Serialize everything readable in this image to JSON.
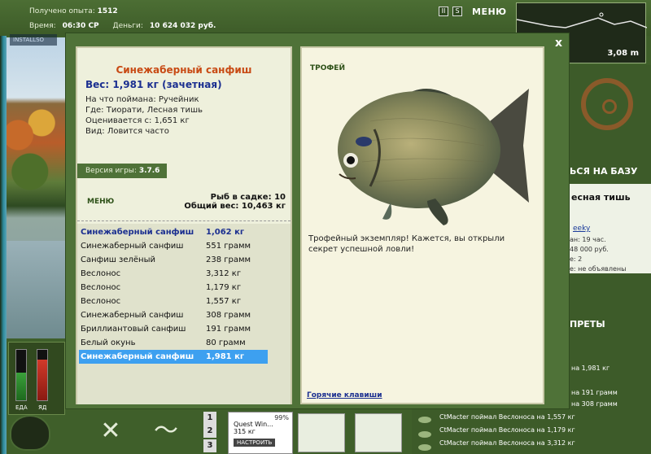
{
  "hud": {
    "exp_label": "Получено опыта:",
    "exp_value": "1512",
    "time_label": "Время:",
    "time_value": "06:30 СР",
    "money_label": "Деньги:",
    "money_value": "10 624 032 руб.",
    "installer_text": "INSTALLSO",
    "btn_pause": "II",
    "btn_s": "S",
    "menu_label": "МЕНЮ",
    "depth_value": "3,08 m"
  },
  "gauges": {
    "food_label": "ЕДА",
    "poison_label": "ЯД",
    "food_level": 0.55,
    "poison_level": 0.8
  },
  "fish": {
    "name": "Синежаберный санфиш",
    "weight_line": "Вес: 1,981 кг (зачетная)",
    "caught_on": "На что поймана: Ручейник",
    "location": "Где: Тиорати, Лесная тишь",
    "valued": "Оценивается с: 1,651 кг",
    "view": "Вид: Ловится часто"
  },
  "version": {
    "label": "Версия игры:",
    "value": "3.7.6"
  },
  "keepnet": {
    "menu_label": "МЕНЮ",
    "count_line": "Рыб в садке: 10",
    "total_line": "Общий вес: 10,463 кг",
    "rows": [
      {
        "name": "Синежаберный санфиш",
        "weight": "1,062 кг"
      },
      {
        "name": "Синежаберный санфиш",
        "weight": "551 грамм"
      },
      {
        "name": "Санфиш зелёный",
        "weight": "238 грамм"
      },
      {
        "name": "Веслонос",
        "weight": "3,312 кг"
      },
      {
        "name": "Веслонос",
        "weight": "1,179 кг"
      },
      {
        "name": "Веслонос",
        "weight": "1,557 кг"
      },
      {
        "name": "Синежаберный санфиш",
        "weight": "308 грамм"
      },
      {
        "name": "Бриллиантовый санфиш",
        "weight": "191 грамм"
      },
      {
        "name": "Белый окунь",
        "weight": "80 грамм"
      },
      {
        "name": "Синежаберный санфиш",
        "weight": "1,981 кг"
      }
    ]
  },
  "trophy": {
    "label": "ТРОФЕЙ",
    "description": "Трофейный экземпляр! Кажется, вы открыли секрет успешной ловли!",
    "hotkeys": "Горячие клавиши"
  },
  "right": {
    "base_title": "ЬСЯ НА БАЗУ",
    "place": "есная тишь",
    "link": "eeky",
    "lines": [
      "ан: 19 час.",
      "48 000 руб.",
      "е: 2",
      "е: не объявлены"
    ],
    "header": "ПРЕТЫ"
  },
  "feed": [
    "на 1,981 кг",
    "на 191 грамм",
    "на 308 грамм",
    "CtMacter поймал Веслоноса на 1,557 кг",
    "CtMacter поймал Веслоноса на 1,179 кг",
    "CtMacter поймал Веслоноса на 3,312 кг"
  ],
  "bottom": {
    "slot1": "1",
    "slot2": "2",
    "slot3": "3",
    "quest_name": "Quest Win...",
    "quest_money": "315 кг",
    "quest_pct": "99%",
    "quest_btn": "НАСТРОИТЬ"
  },
  "close_label": "x"
}
